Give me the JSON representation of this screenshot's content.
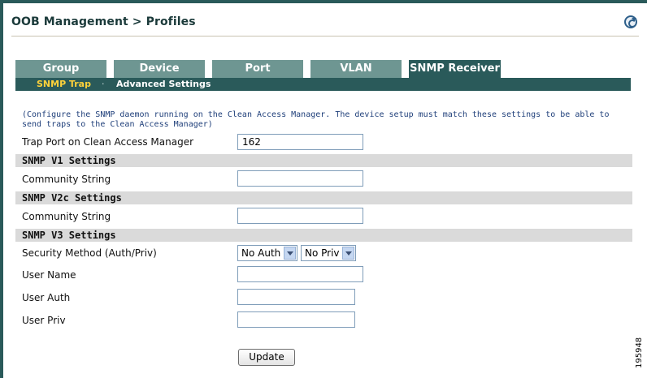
{
  "header": {
    "title": "OOB Management > Profiles",
    "icon": "refresh-help-icon"
  },
  "tabs": [
    {
      "label": "Group",
      "active": false
    },
    {
      "label": "Device",
      "active": false
    },
    {
      "label": "Port",
      "active": false
    },
    {
      "label": "VLAN",
      "active": false
    },
    {
      "label": "SNMP Receiver",
      "active": true
    }
  ],
  "subnav": {
    "active": "SNMP Trap",
    "separator": "·",
    "other": "Advanced Settings"
  },
  "form": {
    "note": "(Configure the SNMP daemon running on the Clean Access Manager. The device setup must match these settings to be able to send traps to the Clean Access Manager)",
    "trap_port_label": "Trap Port on Clean Access Manager",
    "trap_port_value": "162",
    "v1": {
      "title": "SNMP V1 Settings",
      "community_label": "Community String",
      "community_value": ""
    },
    "v2c": {
      "title": "SNMP V2c Settings",
      "community_label": "Community String",
      "community_value": ""
    },
    "v3": {
      "title": "SNMP V3 Settings",
      "security_label": "Security Method (Auth/Priv)",
      "auth_select": "No Auth",
      "priv_select": "No Priv",
      "user_name_label": "User Name",
      "user_name_value": "",
      "user_auth_label": "User Auth",
      "user_auth_value": "",
      "user_priv_label": "User Priv",
      "user_priv_value": ""
    },
    "update_label": "Update"
  },
  "figure_id": "195948",
  "colors": {
    "tab_inactive": "#6e9692",
    "tab_active": "#2a5a5a",
    "subnav_active_text": "#ffd23a",
    "note_text": "#1f3f7a",
    "section_bg": "#dadada"
  }
}
